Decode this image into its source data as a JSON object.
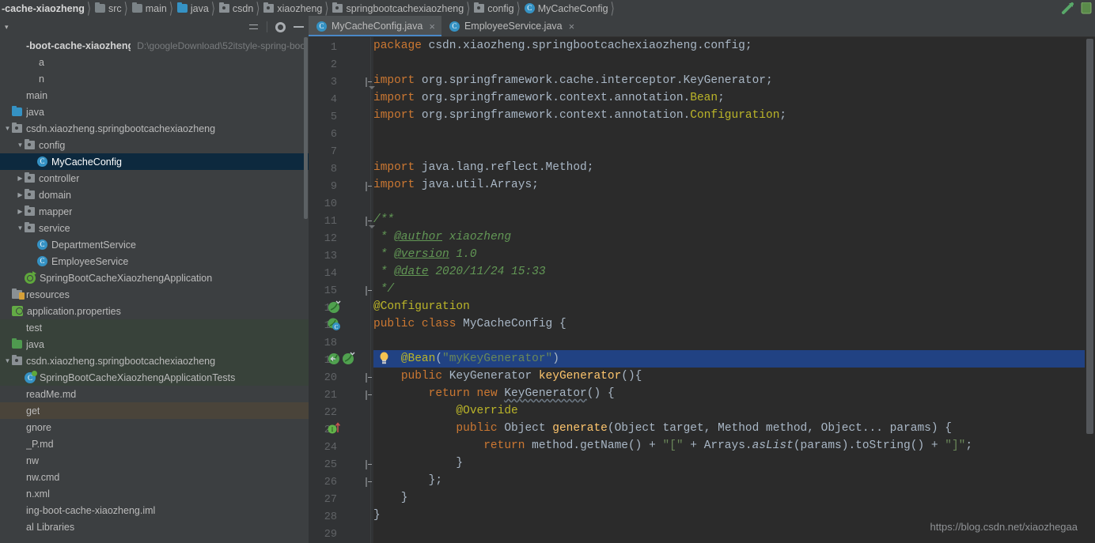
{
  "window": {
    "breadcrumb": [
      {
        "label": "-cache-xiaozheng",
        "icon": "none",
        "bold": true
      },
      {
        "label": "src",
        "icon": "folder-icon"
      },
      {
        "label": "main",
        "icon": "folder-icon"
      },
      {
        "label": "java",
        "icon": "folder-blue-icon"
      },
      {
        "label": "csdn",
        "icon": "package-icon"
      },
      {
        "label": "xiaozheng",
        "icon": "package-icon"
      },
      {
        "label": "springbootcachexiaozheng",
        "icon": "package-icon"
      },
      {
        "label": "config",
        "icon": "package-icon"
      },
      {
        "label": "MyCacheConfig",
        "icon": "class-icon"
      }
    ],
    "title_bar_icons": [
      "run-icon",
      "stop-icon"
    ]
  },
  "project_panel": {
    "header_caret": "▾",
    "tools": [
      "collapse-all-icon",
      "settings-icon",
      "minimize-icon"
    ],
    "tree": [
      {
        "label": "-boot-cache-xiaozheng",
        "path": "D:\\googleDownload\\52itstyle-spring-boo",
        "indent": 0,
        "arrow": "",
        "icon": "none",
        "bold": true,
        "state": "normal"
      },
      {
        "label": "a",
        "indent": 1,
        "arrow": "",
        "icon": "none",
        "state": "normal"
      },
      {
        "label": "n",
        "indent": 1,
        "arrow": "",
        "icon": "none",
        "state": "normal"
      },
      {
        "label": "main",
        "indent": 0,
        "arrow": "",
        "icon": "none",
        "state": "normal"
      },
      {
        "label": "java",
        "indent": 0,
        "arrow": "",
        "icon": "folder-blue-icon",
        "state": "normal"
      },
      {
        "label": "csdn.xiaozheng.springbootcachexiaozheng",
        "indent": 0,
        "arrow": "down",
        "icon": "package-icon",
        "state": "normal"
      },
      {
        "label": "config",
        "indent": 1,
        "arrow": "down",
        "icon": "package-icon",
        "state": "normal"
      },
      {
        "label": "MyCacheConfig",
        "indent": 2,
        "arrow": "",
        "icon": "class-icon",
        "state": "selected"
      },
      {
        "label": "controller",
        "indent": 1,
        "arrow": "right",
        "icon": "package-icon",
        "state": "normal"
      },
      {
        "label": "domain",
        "indent": 1,
        "arrow": "right",
        "icon": "package-icon",
        "state": "normal"
      },
      {
        "label": "mapper",
        "indent": 1,
        "arrow": "right",
        "icon": "package-icon",
        "state": "normal"
      },
      {
        "label": "service",
        "indent": 1,
        "arrow": "down",
        "icon": "package-icon",
        "state": "normal"
      },
      {
        "label": "DepartmentService",
        "indent": 2,
        "arrow": "",
        "icon": "class-icon",
        "state": "normal"
      },
      {
        "label": "EmployeeService",
        "indent": 2,
        "arrow": "",
        "icon": "class-icon",
        "state": "normal"
      },
      {
        "label": "SpringBootCacheXiaozhengApplication",
        "indent": 1,
        "arrow": "",
        "icon": "spring-app-icon",
        "state": "normal"
      },
      {
        "label": "resources",
        "indent": 0,
        "arrow": "",
        "icon": "resources-icon",
        "state": "normal"
      },
      {
        "label": "application.properties",
        "indent": 0,
        "arrow": "",
        "icon": "properties-icon",
        "state": "normal"
      },
      {
        "label": "test",
        "indent": 0,
        "arrow": "",
        "icon": "none",
        "state": "test"
      },
      {
        "label": "java",
        "indent": 0,
        "arrow": "",
        "icon": "folder-green-icon",
        "state": "test"
      },
      {
        "label": "csdn.xiaozheng.springbootcachexiaozheng",
        "indent": 0,
        "arrow": "down",
        "icon": "package-icon",
        "state": "test"
      },
      {
        "label": "SpringBootCacheXiaozhengApplicationTests",
        "indent": 1,
        "arrow": "",
        "icon": "test-class-icon",
        "state": "test"
      },
      {
        "label": "readMe.md",
        "indent": 0,
        "arrow": "",
        "icon": "none",
        "state": "normal"
      },
      {
        "label": "get",
        "indent": 0,
        "arrow": "",
        "icon": "none",
        "state": "excluded"
      },
      {
        "label": "gnore",
        "indent": 0,
        "arrow": "",
        "icon": "none",
        "state": "normal"
      },
      {
        "label": "_P.md",
        "indent": 0,
        "arrow": "",
        "icon": "none",
        "state": "normal"
      },
      {
        "label": "nw",
        "indent": 0,
        "arrow": "",
        "icon": "none",
        "state": "normal"
      },
      {
        "label": "nw.cmd",
        "indent": 0,
        "arrow": "",
        "icon": "none",
        "state": "normal"
      },
      {
        "label": "n.xml",
        "indent": 0,
        "arrow": "",
        "icon": "none",
        "state": "normal"
      },
      {
        "label": "ing-boot-cache-xiaozheng.iml",
        "indent": 0,
        "arrow": "",
        "icon": "none",
        "state": "normal"
      },
      {
        "label": "al Libraries",
        "indent": 0,
        "arrow": "",
        "icon": "none",
        "state": "normal"
      }
    ]
  },
  "editor": {
    "tabs": [
      {
        "label": "MyCacheConfig.java",
        "icon": "class-icon",
        "active": true,
        "close": "×"
      },
      {
        "label": "EmployeeService.java",
        "icon": "class-icon",
        "active": false,
        "close": "×"
      }
    ],
    "line_numbers": [
      "1",
      "2",
      "3",
      "4",
      "5",
      "6",
      "7",
      "8",
      "9",
      "10",
      "11",
      "12",
      "13",
      "14",
      "15",
      "16",
      "17",
      "18",
      "19",
      "20",
      "21",
      "22",
      "23",
      "24",
      "25",
      "26",
      "27",
      "28",
      "29"
    ],
    "highlighted_line": "19",
    "watermark": "https://blog.csdn.net/xiaozhegaa",
    "code_lines": [
      "package csdn.xiaozheng.springbootcachexiaozheng.config;",
      "",
      "import org.springframework.cache.interceptor.KeyGenerator;",
      "import org.springframework.context.annotation.Bean;",
      "import org.springframework.context.annotation.Configuration;",
      "",
      "",
      "import java.lang.reflect.Method;",
      "import java.util.Arrays;",
      "",
      "/**",
      " * @author xiaozheng",
      " * @version 1.0",
      " * @date 2020/11/24 15:33",
      " */",
      "@Configuration",
      "public class MyCacheConfig {",
      "",
      "    @Bean(\"myKeyGenerator\")",
      "    public KeyGenerator keyGenerator(){",
      "        return new KeyGenerator() {",
      "            @Override",
      "            public Object generate(Object target, Method method, Object... params) {",
      "                return method.getName() + \"[\" + Arrays.asList(params).toString() + \"]\";",
      "            }",
      "        };",
      "    }",
      "}",
      ""
    ],
    "gutter_icons": [
      {
        "line": "16",
        "name": "spring-bean-icon"
      },
      {
        "line": "17",
        "name": "spring-config-class-icon"
      },
      {
        "line": "19",
        "name": "spring-bean-navigate-icon"
      },
      {
        "line": "23",
        "name": "implementing-method-icon"
      }
    ],
    "intention_bulb": {
      "line": "19",
      "name": "intention-bulb-icon"
    }
  },
  "colors": {
    "editor_bg": "#2b2b2b",
    "panel_bg": "#3c3f41",
    "gutter_bg": "#313335",
    "selection_blue": "#214283",
    "tree_selection": "#0d293e",
    "accent": "#4a88c7",
    "keyword": "#cc7832",
    "string": "#6a8759",
    "annotation": "#bbb529",
    "comment": "#629755",
    "method": "#ffc66d",
    "text": "#a9b7c6"
  }
}
